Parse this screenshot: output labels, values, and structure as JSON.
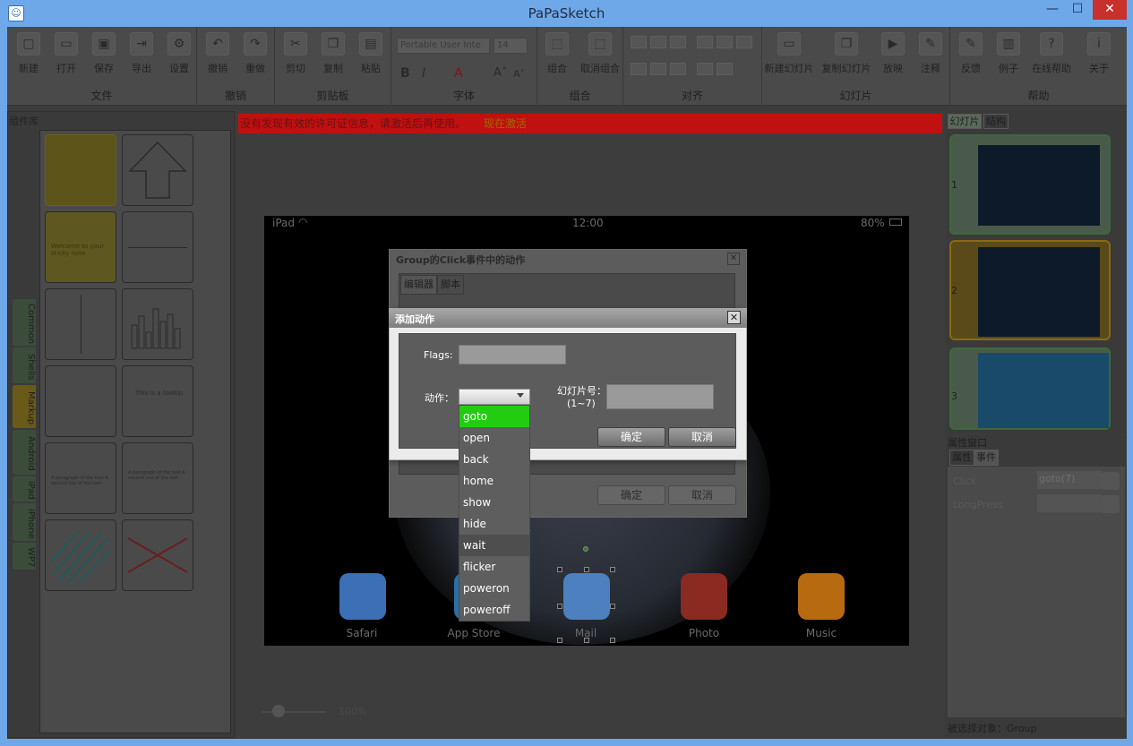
{
  "window": {
    "title": "PaPaSketch"
  },
  "ribbon": {
    "groups": [
      {
        "label": "文件",
        "buttons": [
          "新建",
          "打开",
          "保存",
          "导出",
          "设置"
        ]
      },
      {
        "label": "撤销",
        "buttons": [
          "撤销",
          "重做"
        ]
      },
      {
        "label": "剪贴板",
        "buttons": [
          "剪切",
          "复制",
          "粘贴"
        ]
      },
      {
        "label": "字体",
        "font_name": "Portable User Inte",
        "font_size": "14",
        "bold": "B",
        "italic": "I",
        "color": "A",
        "grow": "A˄",
        "shrink": "A˅"
      },
      {
        "label": "组合",
        "buttons": [
          "组合",
          "取消组合"
        ]
      },
      {
        "label": "对齐"
      },
      {
        "label": "幻灯片",
        "buttons": [
          "新建幻灯片",
          "复制幻灯片",
          "放映",
          "注释"
        ]
      },
      {
        "label": "帮助",
        "buttons": [
          "反馈",
          "例子",
          "在线帮助",
          "关于"
        ]
      }
    ]
  },
  "library": {
    "title": "组件库",
    "tabs": [
      "Common",
      "Shells",
      "Markup",
      "Android",
      "iPad",
      "iPhone",
      "WP7"
    ],
    "shape_texts": {
      "sticky": "Welcome to your sticky note",
      "tooltip": "This is a tooltip",
      "paragraph": "A paragraph of the text A second line of the text"
    }
  },
  "banner": {
    "text": "没有发现有效的许可证信息，请激活后再使用。",
    "action": "现在激活"
  },
  "ipad": {
    "carrier": "iPad",
    "time": "12:00",
    "battery": "80%",
    "dock": [
      {
        "label": "Safari",
        "color": "#3b6fb6"
      },
      {
        "label": "App Store",
        "color": "#2a6fa8"
      },
      {
        "label": "Mail",
        "color": "#4c80bf"
      },
      {
        "label": "Photo",
        "color": "#8a2a20"
      },
      {
        "label": "Music",
        "color": "#b86a10"
      }
    ]
  },
  "zoom": {
    "value": "100%"
  },
  "slides_panel": {
    "tabs": [
      "幻灯片",
      "结构"
    ],
    "numbers": [
      "1",
      "2",
      "3"
    ]
  },
  "properties": {
    "title": "属性窗口",
    "tabs": [
      "属性",
      "事件"
    ],
    "rows": [
      {
        "event": "Click",
        "value": "goto(7)"
      },
      {
        "event": "LongPress",
        "value": ""
      }
    ],
    "selected_object": "被选择对象：Group"
  },
  "outer_dialog": {
    "title": "Group的Click事件中的动作",
    "tabs": [
      "编辑器",
      "脚本"
    ],
    "ok": "确定",
    "cancel": "取消"
  },
  "dialog": {
    "title": "添加动作",
    "flags_label": "Flags:",
    "flags_value": "",
    "action_label": "动作：",
    "action_value": "",
    "slide_label": "幻灯片号：",
    "slide_range": "(1~7)",
    "slide_value": "",
    "ok": "确定",
    "cancel": "取消",
    "options": [
      "goto",
      "open",
      "back",
      "home",
      "show",
      "hide",
      "wait",
      "flicker",
      "poweron",
      "poweroff"
    ],
    "highlighted": "goto",
    "hovered": "wait"
  },
  "colors": {
    "highlight": "#22cc11",
    "banner": "#c01010"
  }
}
